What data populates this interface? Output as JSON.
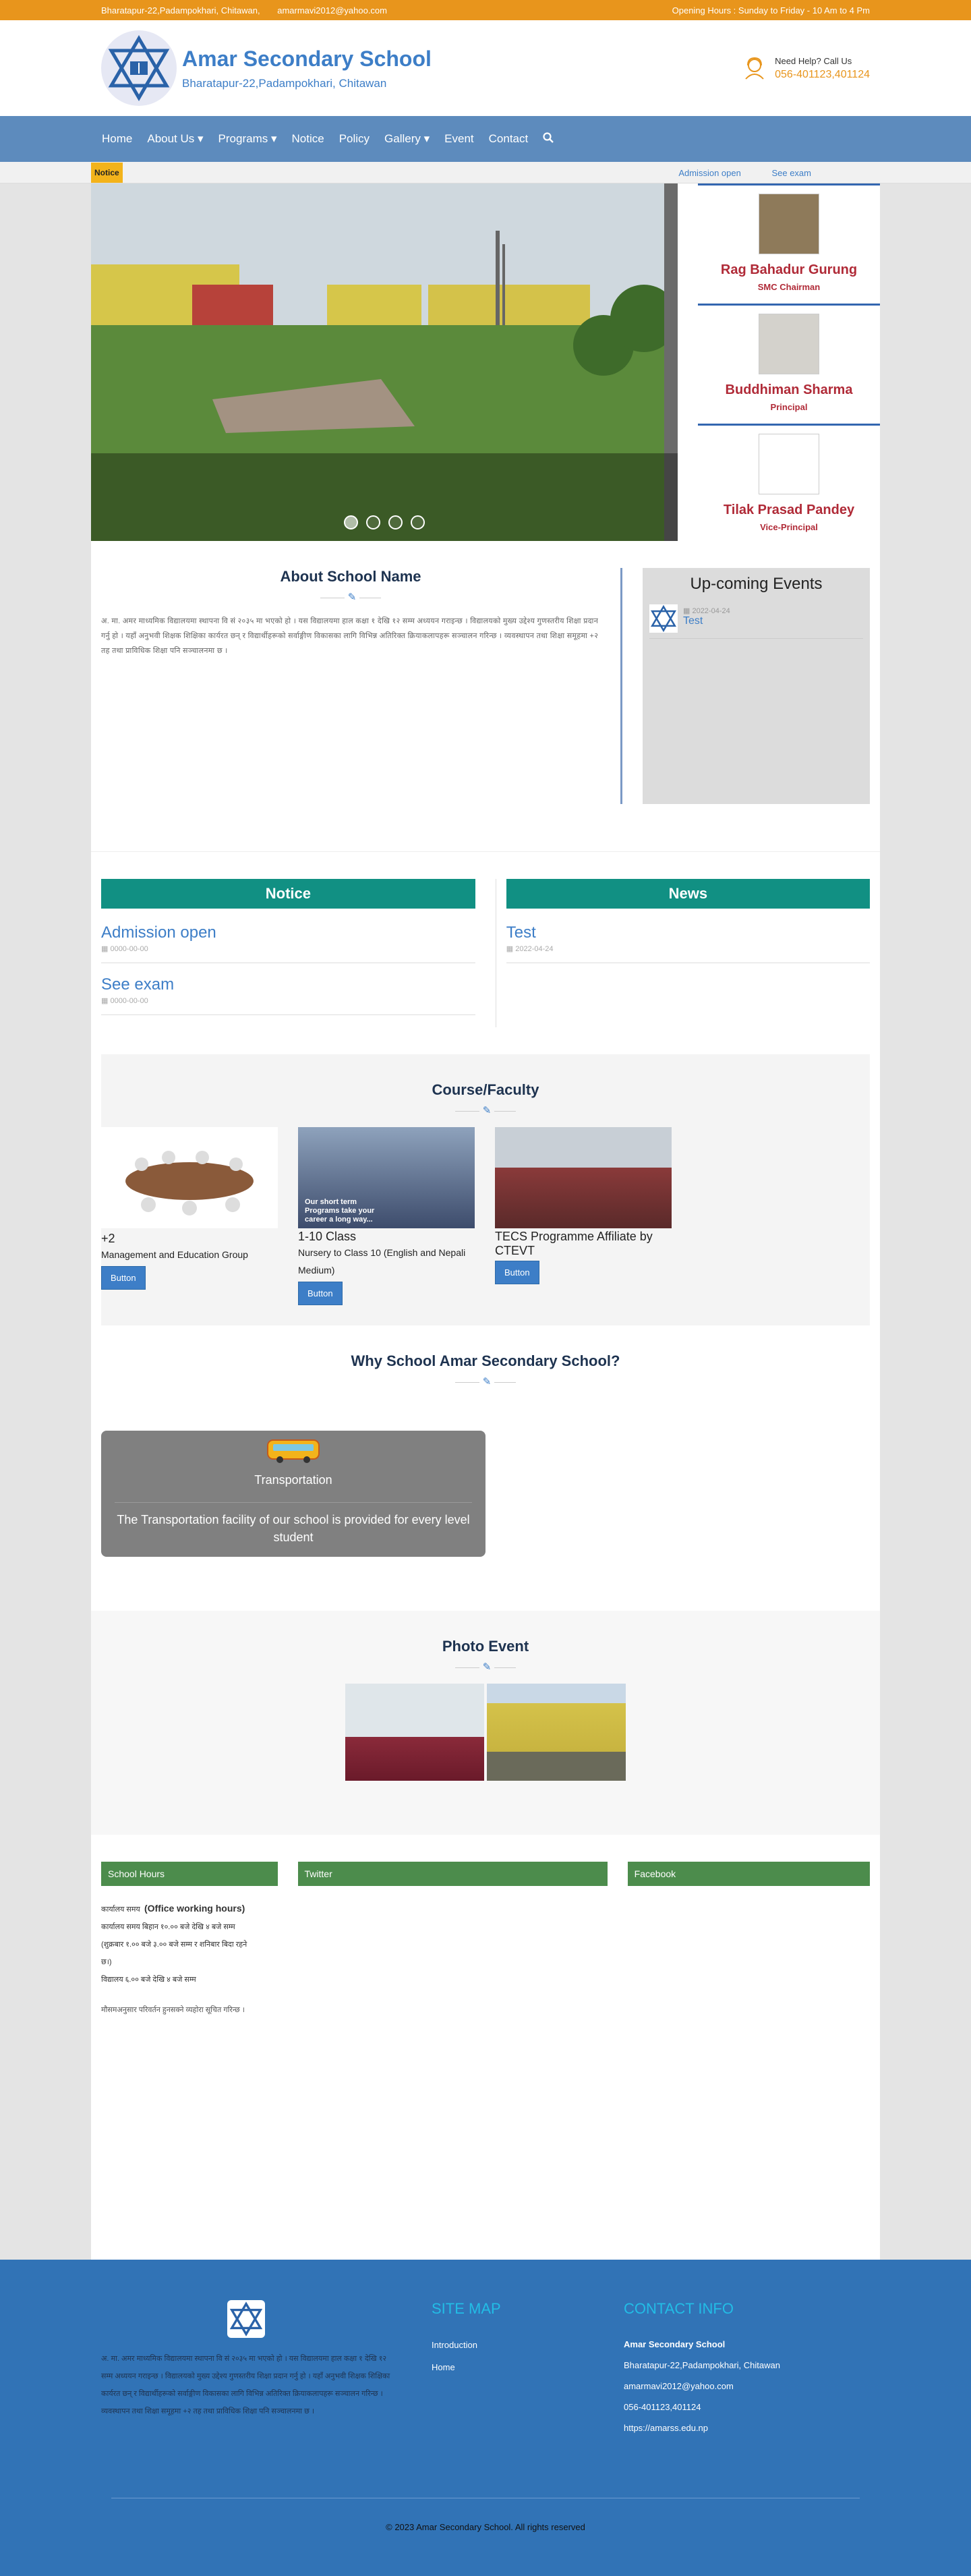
{
  "topbar": {
    "address": "Bharatapur-22,Padampokhari, Chitawan,",
    "email": "amarmavi2012@yahoo.com",
    "hours": "Opening Hours : Sunday to Friday - 10 Am to 4 Pm"
  },
  "header": {
    "school_name": "Amar Secondary School",
    "address": "Bharatapur-22,Padampokhari, Chitawan",
    "help_label": "Need Help? Call Us",
    "phone": "056-401123,401124"
  },
  "nav": {
    "items": [
      "Home",
      "About Us ▾",
      "Programs ▾",
      "Notice",
      "Policy",
      "Gallery ▾",
      "Event",
      "Contact"
    ]
  },
  "noticebar": {
    "tag": "Notice",
    "items": [
      "Admission open",
      "See exam"
    ]
  },
  "people": [
    {
      "name": "Rag Bahadur Gurung",
      "role": "SMC Chairman"
    },
    {
      "name": "Buddhiman Sharma",
      "role": "Principal"
    },
    {
      "name": "Tilak Prasad Pandey",
      "role": "Vice-Principal"
    }
  ],
  "about": {
    "title": "About School Name",
    "text": "अ. मा. अमर माध्यमिक विद्यालयमा स्थापना वि सं २०३५ मा भएको हो । यस विद्यालयमा हाल कक्षा १ देखि १२ सम्म अध्ययन गराइन्छ । विद्यालयको मुख्य उद्देश्य गुणस्तरीय शिक्षा प्रदान गर्नु हो । यहाँ अनुभवी शिक्षक शिक्षिका कार्यरत छन् र विद्यार्थीहरूको सर्वाङ्गीण विकासका लागि विभिन्न अतिरिक्त क्रियाकलापहरू सञ्चालन गरिन्छ । व्यवस्थापन तथा शिक्षा समूहमा +२ तह तथा प्राविधिक शिक्षा पनि सञ्चालनमा छ ।"
  },
  "events": {
    "title": "Up-coming Events",
    "items": [
      {
        "date": "2022-04-24",
        "title": "Test"
      }
    ]
  },
  "notice": {
    "title": "Notice",
    "items": [
      {
        "title": "Admission open",
        "date": "0000-00-00"
      },
      {
        "title": "See exam",
        "date": "0000-00-00"
      }
    ]
  },
  "news": {
    "title": "News",
    "items": [
      {
        "title": "Test",
        "date": "2022-04-24"
      }
    ]
  },
  "course": {
    "title": "Course/Faculty",
    "items": [
      {
        "name": "+2",
        "desc": "Management and Education Group",
        "button": "Button"
      },
      {
        "name": "1-10 Class",
        "desc": "Nursery to Class 10 (English and Nepali Medium)",
        "button": "Button",
        "img_text": "Our short term Programs take your career a long way..."
      },
      {
        "name": "TECS Programme Affiliate by CTEVT",
        "desc": "",
        "button": "Button"
      }
    ]
  },
  "why": {
    "title": "Why School Amar Secondary School?",
    "card_title": "Transportation",
    "card_text": "The Transportation facility of our school is provided for every level student"
  },
  "photo": {
    "title": "Photo Event"
  },
  "widgets": {
    "hours_title": "School Hours",
    "hours_label": "कार्यालय समय",
    "hours_bold": "(Office working hours)",
    "hours_lines": [
      "कार्यालय समय बिहान १०.०० बजे देखि ४ बजे सम्म",
      "(शुक्रबार १.०० बजे ३.०० बजे सम्म र शनिबार बिदा रहने",
      "छ।)",
      "विद्यालय ६.०० बजे देखि ४ बजे सम्म"
    ],
    "hours_extra": "मौसमअनुसार परिवर्तन हुनसक्ने व्यहोरा सूचित गरिन्छ ।",
    "twitter_title": "Twitter",
    "facebook_title": "Facebook"
  },
  "footer": {
    "about_text": "अ. मा. अमर माध्यमिक विद्यालयमा स्थापना वि सं २०३५ मा भएको हो । यस विद्यालयमा हाल कक्षा १ देखि १२ सम्म अध्ययन गराइन्छ । विद्यालयको मुख्य उद्देश्य गुणस्तरीय शिक्षा प्रदान गर्नु हो । यहाँ अनुभवी शिक्षक शिक्षिका कार्यरत छन् र विद्यार्थीहरूको सर्वाङ्गीण विकासका लागि विभिन्न अतिरिक्त क्रियाकलापहरू सञ्चालन गरिन्छ । व्यवस्थापन तथा शिक्षा समूहमा +२ तह तथा प्राविधिक शिक्षा पनि सञ्चालनमा छ ।",
    "sitemap_title": "SITE MAP",
    "sitemap": [
      "Introduction",
      "Home"
    ],
    "contact_title": "CONTACT INFO",
    "contact": [
      "Amar Secondary School",
      "Bharatapur-22,Padampokhari, Chitawan",
      "amarmavi2012@yahoo.com",
      "056-401123,401124",
      "https://amarss.edu.np"
    ],
    "copyright": "© 2023 Amar Secondary School. All rights reserved"
  }
}
